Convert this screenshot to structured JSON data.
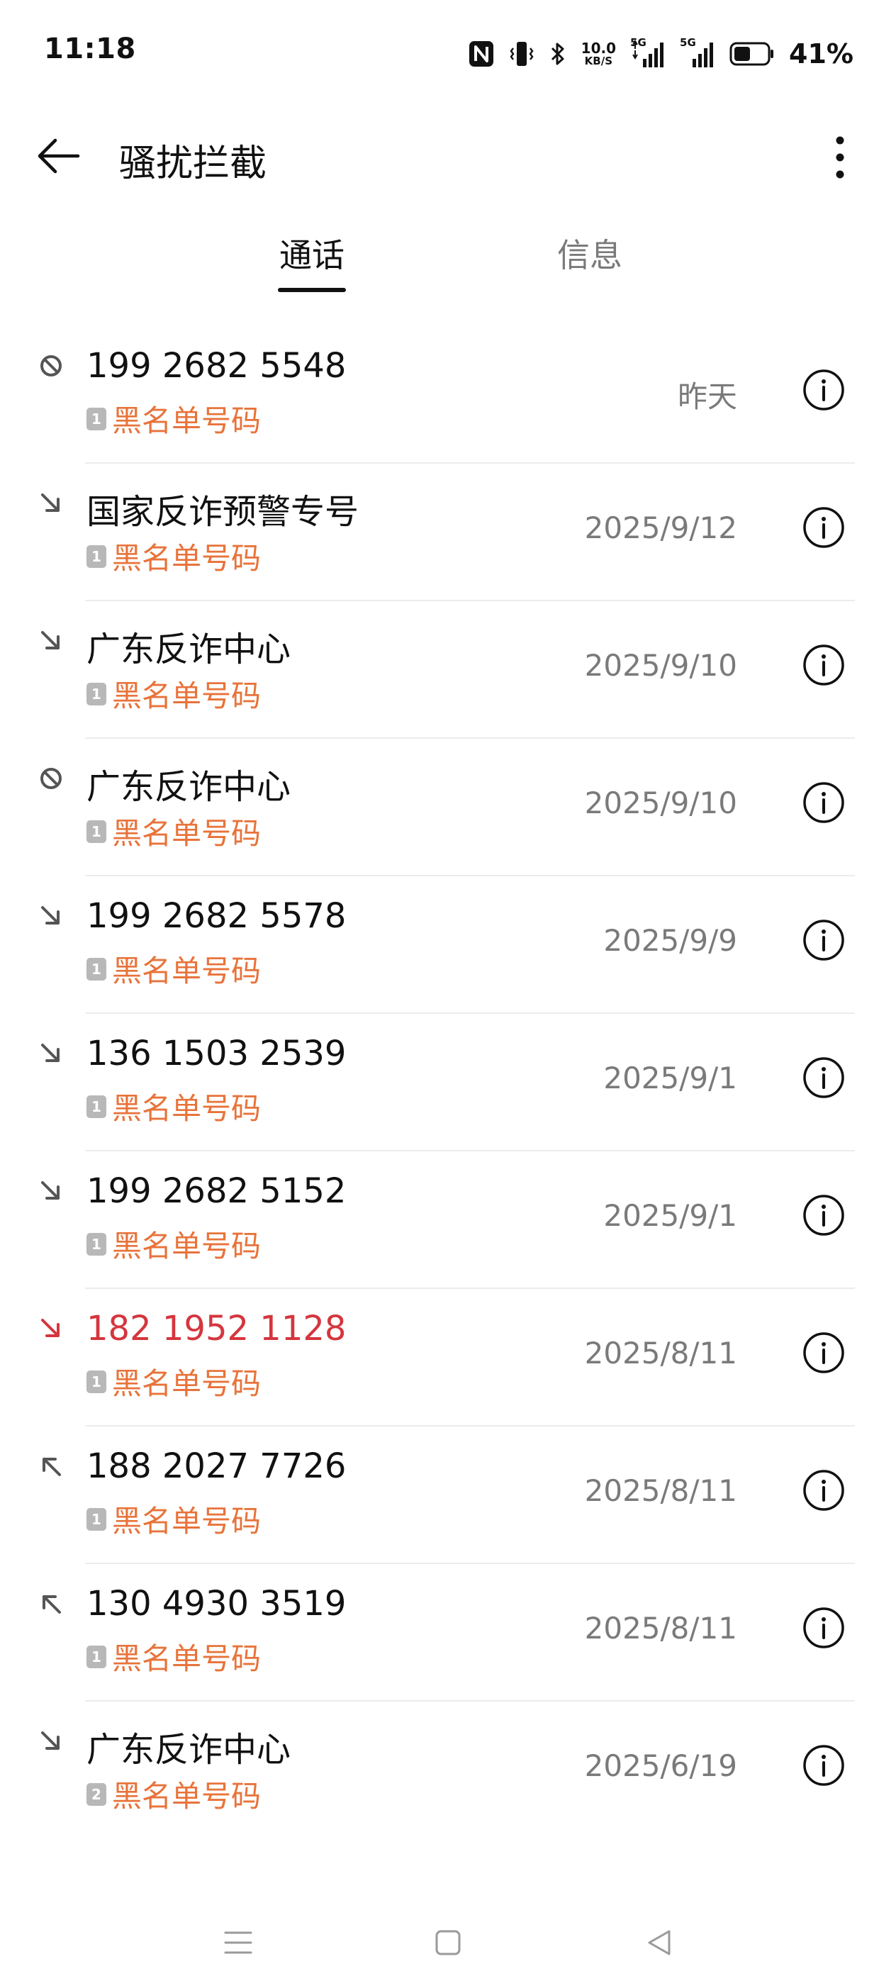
{
  "status_bar": {
    "time": "11:18",
    "net_speed_value": "10.0",
    "net_speed_unit": "KB/S",
    "signal_1_label": "5G",
    "signal_2_label": "5G",
    "battery_percent": "41%",
    "icons": [
      "nfc-icon",
      "vibrate-icon",
      "bluetooth-icon",
      "signal-icon",
      "signal-icon",
      "battery-icon"
    ]
  },
  "header": {
    "title": "骚扰拦截",
    "back_icon": "arrow-left-icon",
    "more_icon": "more-vertical-icon"
  },
  "tabs": [
    {
      "label": "通话",
      "active": true
    },
    {
      "label": "信息",
      "active": false
    }
  ],
  "calls": [
    {
      "name": "199 2682 5548",
      "sim": "1",
      "tag": "黑名单号码",
      "date": "昨天",
      "type": "blocked",
      "missed": false
    },
    {
      "name": "国家反诈预警专号",
      "sim": "1",
      "tag": "黑名单号码",
      "date": "2025/9/12",
      "type": "incoming",
      "missed": false
    },
    {
      "name": "广东反诈中心",
      "sim": "1",
      "tag": "黑名单号码",
      "date": "2025/9/10",
      "type": "incoming",
      "missed": false
    },
    {
      "name": "广东反诈中心",
      "sim": "1",
      "tag": "黑名单号码",
      "date": "2025/9/10",
      "type": "blocked",
      "missed": false
    },
    {
      "name": "199 2682 5578",
      "sim": "1",
      "tag": "黑名单号码",
      "date": "2025/9/9",
      "type": "incoming",
      "missed": false
    },
    {
      "name": "136 1503 2539",
      "sim": "1",
      "tag": "黑名单号码",
      "date": "2025/9/1",
      "type": "incoming",
      "missed": false
    },
    {
      "name": "199 2682 5152",
      "sim": "1",
      "tag": "黑名单号码",
      "date": "2025/9/1",
      "type": "incoming",
      "missed": false
    },
    {
      "name": "182 1952 1128",
      "sim": "1",
      "tag": "黑名单号码",
      "date": "2025/8/11",
      "type": "missed",
      "missed": true
    },
    {
      "name": "188 2027 7726",
      "sim": "1",
      "tag": "黑名单号码",
      "date": "2025/8/11",
      "type": "outgoing",
      "missed": false
    },
    {
      "name": "130 4930 3519",
      "sim": "1",
      "tag": "黑名单号码",
      "date": "2025/8/11",
      "type": "outgoing",
      "missed": false
    },
    {
      "name": "广东反诈中心",
      "sim": "2",
      "tag": "黑名单号码",
      "date": "2025/6/19",
      "type": "incoming",
      "missed": false
    }
  ],
  "colors": {
    "tag": "#e8733a",
    "missed": "#d4363e",
    "secondary_text": "#7a7a7a",
    "divider": "#ececec"
  },
  "nav_bar": {
    "icons": [
      "menu-icon",
      "home-square-icon",
      "back-triangle-icon"
    ]
  }
}
